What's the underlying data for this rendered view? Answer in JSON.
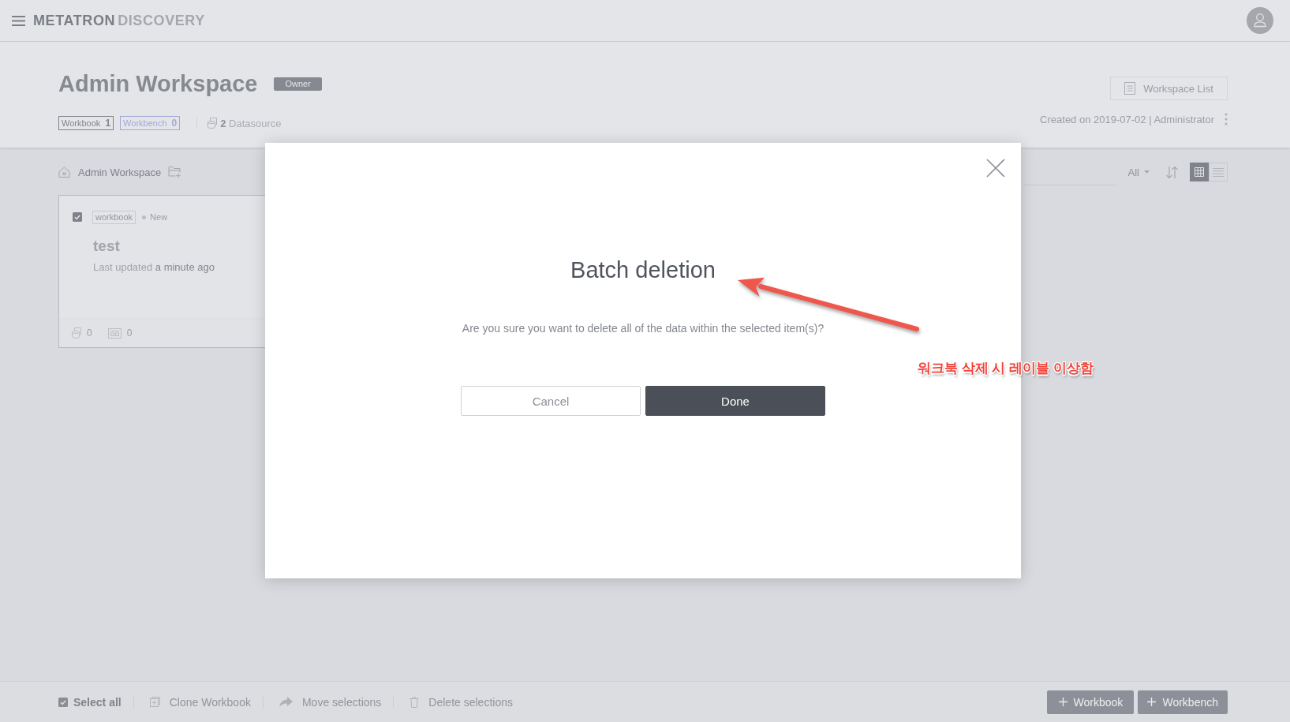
{
  "header": {
    "logo": {
      "primary": "METATRON",
      "secondary": "DISCOVERY"
    }
  },
  "workspace": {
    "title": "Admin Workspace",
    "role": "Owner",
    "counts": [
      {
        "label": "Workbook",
        "count": "1",
        "color": "#81848b"
      },
      {
        "label": "Workbench",
        "count": "0",
        "color": "#a4a8d8"
      }
    ],
    "datasource": {
      "count": "2",
      "label": "Datasource"
    },
    "list_button": "Workspace List",
    "created": "Created on 2019-07-02 | Administrator"
  },
  "toolbar": {
    "breadcrumb": "Admin Workspace",
    "filter": "All",
    "views": [
      {
        "kind": "grid",
        "selected": true
      },
      {
        "kind": "list",
        "selected": false
      }
    ]
  },
  "cards": [
    {
      "checked": true,
      "tag": "workbook",
      "status": "New",
      "title": "test",
      "updated_label": "Last updated",
      "updated_value": "a minute ago",
      "datasources": "0",
      "dashboards": "0"
    }
  ],
  "bottom_bar": {
    "select_all": {
      "label": "Select all",
      "checked": true
    },
    "actions": [
      {
        "kind": "clone",
        "label": "Clone Workbook"
      },
      {
        "kind": "move",
        "label": "Move selections"
      },
      {
        "kind": "delete",
        "label": "Delete selections"
      }
    ],
    "create_buttons": [
      "Workbook",
      "Workbench"
    ]
  },
  "dialog": {
    "title": "Batch deletion",
    "message": "Are you sure you want to delete all of the data within the selected item(s)?",
    "buttons": [
      {
        "kind": "secondary",
        "label": "Cancel"
      },
      {
        "kind": "primary",
        "label": "Done"
      }
    ]
  },
  "annotation": {
    "text": "워크북 삭제 시 레이블 이상함"
  }
}
